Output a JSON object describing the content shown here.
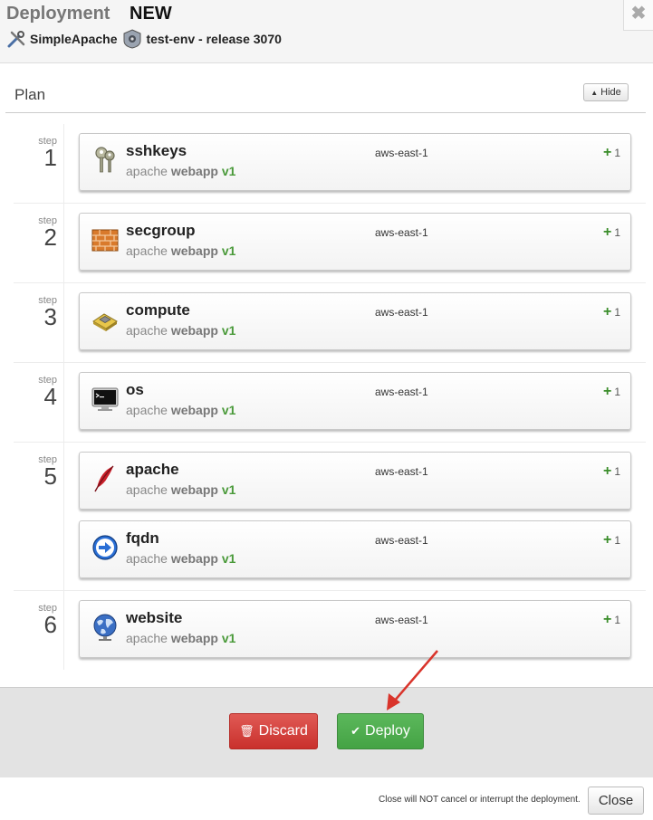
{
  "header": {
    "title_label": "Deployment",
    "title_state": "NEW",
    "assembly": "SimpleApache",
    "environment": "test-env - release 3070",
    "close_symbol": "✖"
  },
  "plan": {
    "title": "Plan",
    "hide_label": "Hide"
  },
  "step_word": "step",
  "steps": [
    {
      "number": "1",
      "components": [
        {
          "name": "sshkeys",
          "icon": "keys-icon",
          "meta_pack": "apache",
          "meta_platform": "webapp",
          "meta_version": "v1",
          "region": "aws-east-1",
          "count": "1"
        }
      ]
    },
    {
      "number": "2",
      "components": [
        {
          "name": "secgroup",
          "icon": "firewall-icon",
          "meta_pack": "apache",
          "meta_platform": "webapp",
          "meta_version": "v1",
          "region": "aws-east-1",
          "count": "1"
        }
      ]
    },
    {
      "number": "3",
      "components": [
        {
          "name": "compute",
          "icon": "cpu-icon",
          "meta_pack": "apache",
          "meta_platform": "webapp",
          "meta_version": "v1",
          "region": "aws-east-1",
          "count": "1"
        }
      ]
    },
    {
      "number": "4",
      "components": [
        {
          "name": "os",
          "icon": "terminal-icon",
          "meta_pack": "apache",
          "meta_platform": "webapp",
          "meta_version": "v1",
          "region": "aws-east-1",
          "count": "1"
        }
      ]
    },
    {
      "number": "5",
      "components": [
        {
          "name": "apache",
          "icon": "feather-icon",
          "meta_pack": "apache",
          "meta_platform": "webapp",
          "meta_version": "v1",
          "region": "aws-east-1",
          "count": "1"
        },
        {
          "name": "fqdn",
          "icon": "arrow-circle-icon",
          "meta_pack": "apache",
          "meta_platform": "webapp",
          "meta_version": "v1",
          "region": "aws-east-1",
          "count": "1"
        }
      ]
    },
    {
      "number": "6",
      "components": [
        {
          "name": "website",
          "icon": "globe-icon",
          "meta_pack": "apache",
          "meta_platform": "webapp",
          "meta_version": "v1",
          "region": "aws-east-1",
          "count": "1"
        }
      ]
    }
  ],
  "actions": {
    "discard_label": "Discard",
    "deploy_label": "Deploy"
  },
  "footer": {
    "note": "Close will NOT cancel or interrupt the deployment.",
    "close_label": "Close"
  },
  "colors": {
    "discard": "#d9534f",
    "deploy": "#5cb85c",
    "version": "#4a9a3a",
    "annotation_arrow": "#d9342b"
  }
}
